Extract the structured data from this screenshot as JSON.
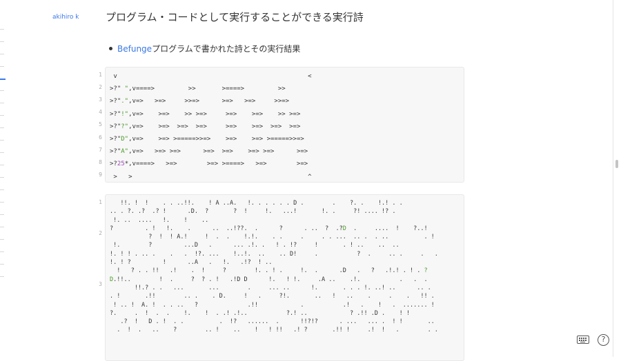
{
  "author": "akihiro k",
  "title": "プログラム・コードとして実行することができる実行詩",
  "bullet": {
    "link": "Befunge",
    "text": "プログラムで書かれた詩とその実行結果"
  },
  "code1": {
    "line_numbers": [
      "1",
      "2",
      "3",
      "4",
      "5",
      "6",
      "7",
      "8",
      "9"
    ],
    "lines": [
      [
        {
          "t": " v                                                   <"
        }
      ],
      [
        {
          "t": ">?\""
        },
        {
          "t": " \"",
          "c": "green"
        },
        {
          "t": ",v====>         >>       >====>         >>"
        }
      ],
      [
        {
          "t": ">?\""
        },
        {
          "t": ".\"",
          "c": "green"
        },
        {
          "t": ",v=>   >=>     >>=>      >=>   >=>     >>=>"
        }
      ],
      [
        {
          "t": ">?\""
        },
        {
          "t": "!\"",
          "c": "green"
        },
        {
          "t": ",v=>    >=>    >> >=>     >=>    >=>    >> >=>"
        }
      ],
      [
        {
          "t": ">?\""
        },
        {
          "t": "?\"",
          "c": "green"
        },
        {
          "t": ",v=>    >=>  >=>  >=>     >=>    >=>  >=>  >=>"
        }
      ],
      [
        {
          "t": ">?\""
        },
        {
          "t": "D\"",
          "c": "green"
        },
        {
          "t": ",v=>    >=> >=====>>=>    >=>    >=> >=====>>=>"
        }
      ],
      [
        {
          "t": ">?\""
        },
        {
          "t": "A\"",
          "c": "green"
        },
        {
          "t": ",v=>   >=> >=>      >=>  >=>    >=> >=>      >=>"
        }
      ],
      [
        {
          "t": ">?"
        },
        {
          "t": "25",
          "c": "purple"
        },
        {
          "t": "*,v====>   >=>        >=> >====>   >=>        >=>"
        }
      ],
      [
        {
          "t": " >   >                                               ^"
        }
      ]
    ]
  },
  "code2": {
    "line_numbers": [
      "1",
      "2",
      "3"
    ],
    "lines": [
      [
        {
          "t": "   !!. !  !    . . ..!!.    ! A ..A.   !. . . . . . D .        .    ?. .    !.! . ."
        }
      ],
      [
        {
          "t": ".. . ?. .?  .? !      .D.  ?       ?  !     !.   ...!       !. .     ?! .... !? ."
        }
      ],
      [
        {
          "t": " !. ..  ....   !.    !    .."
        }
      ],
      [
        {
          "t": "?         . !   !.    .      ..  ..!??.  .      ?      . ..  ?  .?"
        },
        {
          "t": "D",
          "c": "green"
        },
        {
          "t": "  .     ....  !    ?..!"
        }
      ],
      [
        {
          "t": "           ?  !  ! A.!     !  .  .    !.!.    . .     .     . . ...  .. .  . ..          . !"
        }
      ],
      [
        {
          "t": " !.        ?         ...D   .      ... .!. .   ! . !?     !       . ! ..    ..  .."
        }
      ],
      [
        {
          "t": "!. ! ! . .. .    .   .  !?. ...    !..!.  ..    .. D!     .           ?  .     .. .     .   ."
        }
      ],
      [
        {
          "t": "!. ! ?         !      ..A   .   !.   .!?  ! .."
        }
      ],
      [
        {
          "t": "  !   ? . . !!   .!    .  !     ?        !. . ! .     !.  .      .D   .   ?   .!.! . ! . "
        },
        {
          "t": "?",
          "c": "green"
        }
      ],
      [
        {
          "t": ""
        },
        {
          "t": "D",
          "c": "green"
        },
        {
          "t": ".!!..        !  .     ?  ? . !   .!D D      !.   ! !.     .A ..    .!.           .   .  ."
        }
      ],
      [
        {
          "t": "       !!.? . .   ...       ...        .     ... ..      !.       . . . !. ..! ..      .. ."
        }
      ],
      [
        {
          "t": ". !       .!!        .. .    . D.     !   .     ?!.       ..   !   ..    .     .    .   !! ."
        }
      ],
      [
        {
          "t": " ! .. !  A. !  . . ..   ?              .!!            .           .!   .    !   .  ....... !"
        }
      ],
      [
        {
          "t": "?.     .  !  .  .    !.    !  . .! .!..           ?.! ..            ? .!! .D .    ! !"
        }
      ],
      [
        {
          "t": "   .?  !   D . !  . .          .  !?   ......  .      !!?!?      . ...   ... .  ! !       .."
        }
      ],
      [
        {
          "t": "  .  !  .   ..    ?        .. !    ..    !   ! !!   .! ?       .!! !     .!  !   .        . ."
        }
      ]
    ]
  },
  "icons": {
    "keyboard": "keyboard-icon",
    "help": "help-icon",
    "help_glyph": "?"
  }
}
